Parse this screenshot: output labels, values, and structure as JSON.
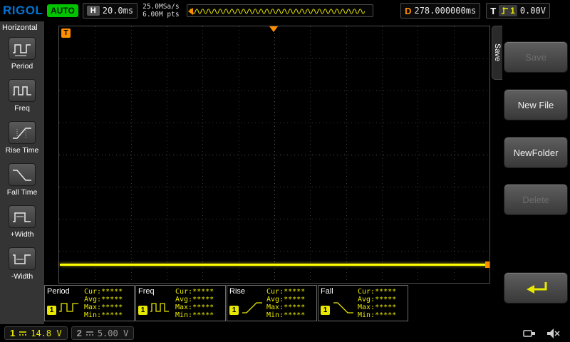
{
  "colors": {
    "trace_yellow": "#ffff00",
    "orange": "#ff8d00",
    "status_green": "#00c400",
    "logo_blue": "#0074d4",
    "disabled_gray": "#6c6c6c"
  },
  "top_bar": {
    "logo": "RIGOL",
    "run_status": "AUTO",
    "horizontal": {
      "label": "H",
      "timebase": "20.0ms"
    },
    "acquisition": {
      "sample_rate": "25.0MSa/s",
      "memory_depth": "6.00M pts"
    },
    "delay": {
      "label": "D",
      "value": "278.000000ms"
    },
    "trigger": {
      "label": "T",
      "source_channel": "1",
      "level": "0.00V"
    }
  },
  "left_sidebar": {
    "title": "Horizontal",
    "items": [
      {
        "label": "Period",
        "icon": "period-icon"
      },
      {
        "label": "Freq",
        "icon": "freq-icon"
      },
      {
        "label": "Rise Time",
        "icon": "rise-time-icon"
      },
      {
        "label": "Fall Time",
        "icon": "fall-time-icon"
      },
      {
        "label": "+Width",
        "icon": "plus-width-icon"
      },
      {
        "label": "-Width",
        "icon": "minus-width-icon"
      }
    ]
  },
  "grid": {
    "trigger_position_marker": "T"
  },
  "measurements": [
    {
      "name": "Period",
      "channel": "1",
      "rows": [
        "Cur:*****",
        "Avg:*****",
        "Max:*****",
        "Min:*****"
      ]
    },
    {
      "name": "Freq",
      "channel": "1",
      "rows": [
        "Cur:*****",
        "Avg:*****",
        "Max:*****",
        "Min:*****"
      ]
    },
    {
      "name": "Rise",
      "channel": "1",
      "rows": [
        "Cur:*****",
        "Avg:*****",
        "Max:*****",
        "Min:*****"
      ]
    },
    {
      "name": "Fall",
      "channel": "1",
      "rows": [
        "Cur:*****",
        "Avg:*****",
        "Max:*****",
        "Min:*****"
      ]
    }
  ],
  "right_menu": {
    "tab_label": "Save",
    "buttons": [
      {
        "label": "Save",
        "enabled": false
      },
      {
        "label": "New File",
        "enabled": true
      },
      {
        "label": "NewFolder",
        "enabled": true
      },
      {
        "label": "Delete",
        "enabled": false
      }
    ],
    "back_button": {
      "icon": "return-arrow-icon"
    }
  },
  "bottom_bar": {
    "channel1": {
      "number": "1",
      "scale": "14.8 V"
    },
    "channel2": {
      "number": "2",
      "scale": "5.00 V"
    }
  }
}
